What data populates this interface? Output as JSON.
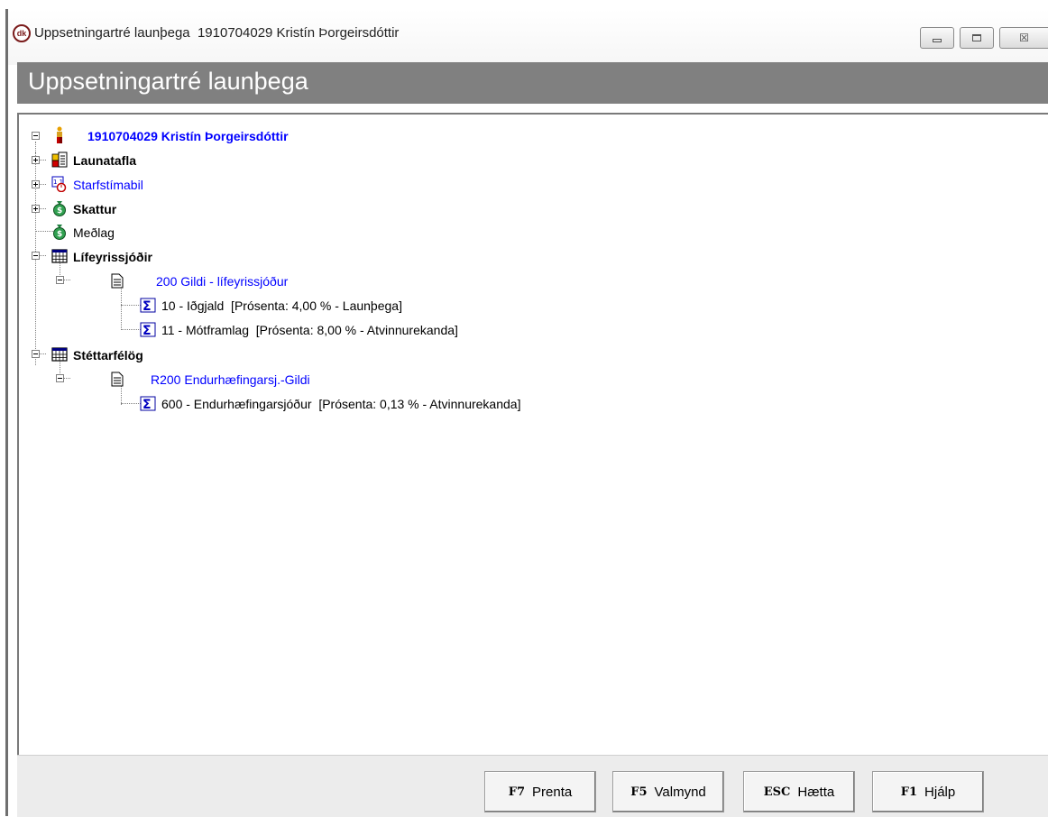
{
  "window": {
    "title": "Uppsetningartré launþega  1910704029 Kristín Þorgeirsdóttir",
    "icon_text": "dk",
    "controls": [
      "minimize-icon",
      "maximize-icon",
      "close-icon"
    ],
    "close_glyph": "☒"
  },
  "header": {
    "title": "Uppsetningartré launþega"
  },
  "tree": {
    "root": {
      "label": "1910704029 Kristín Þorgeirsdóttir",
      "icon": "person-icon"
    },
    "launatafla": {
      "label": "Launatafla",
      "icon": "pay-table-icon"
    },
    "starfstimabil": {
      "label": "Starfstímabil",
      "icon": "calendar-period-icon"
    },
    "skattur": {
      "label": "Skattur",
      "icon": "money-bag-icon"
    },
    "medlag": {
      "label": "Meðlag",
      "icon": "money-bag-icon"
    },
    "lifeyrissjodir": {
      "label": "Lífeyrissjóðir",
      "icon": "grid-table-icon"
    },
    "lif_group": {
      "label": "200 Gildi - lífeyrissjóður",
      "icon": "document-icon"
    },
    "lif_item1": {
      "label": "10 - Iðgjald  [Prósenta: 4,00 % - Launþega]",
      "icon": "sigma-icon"
    },
    "lif_item2": {
      "label": "11 - Mótframlag  [Prósenta: 8,00 % - Atvinnurekanda]",
      "icon": "sigma-icon"
    },
    "stettarfelog": {
      "label": "Stéttarfélög",
      "icon": "grid-table-icon"
    },
    "stett_group": {
      "label": "R200 Endurhæfingarsj.-Gildi",
      "icon": "document-icon"
    },
    "stett_item1": {
      "label": "600 - Endurhæfingarsjóður  [Prósenta: 0,13 % - Atvinnurekanda]",
      "icon": "sigma-icon"
    }
  },
  "footer": {
    "print": {
      "key": "F7",
      "label": "Prenta"
    },
    "menu": {
      "key": "F5",
      "label": "Valmynd"
    },
    "quit": {
      "key": "ESC",
      "label": "Hætta"
    },
    "help": {
      "key": "F1",
      "label": "Hjálp"
    }
  },
  "colors": {
    "link_blue": "#0000ff",
    "header_band": "#808080",
    "footer_bg": "#ececec"
  }
}
